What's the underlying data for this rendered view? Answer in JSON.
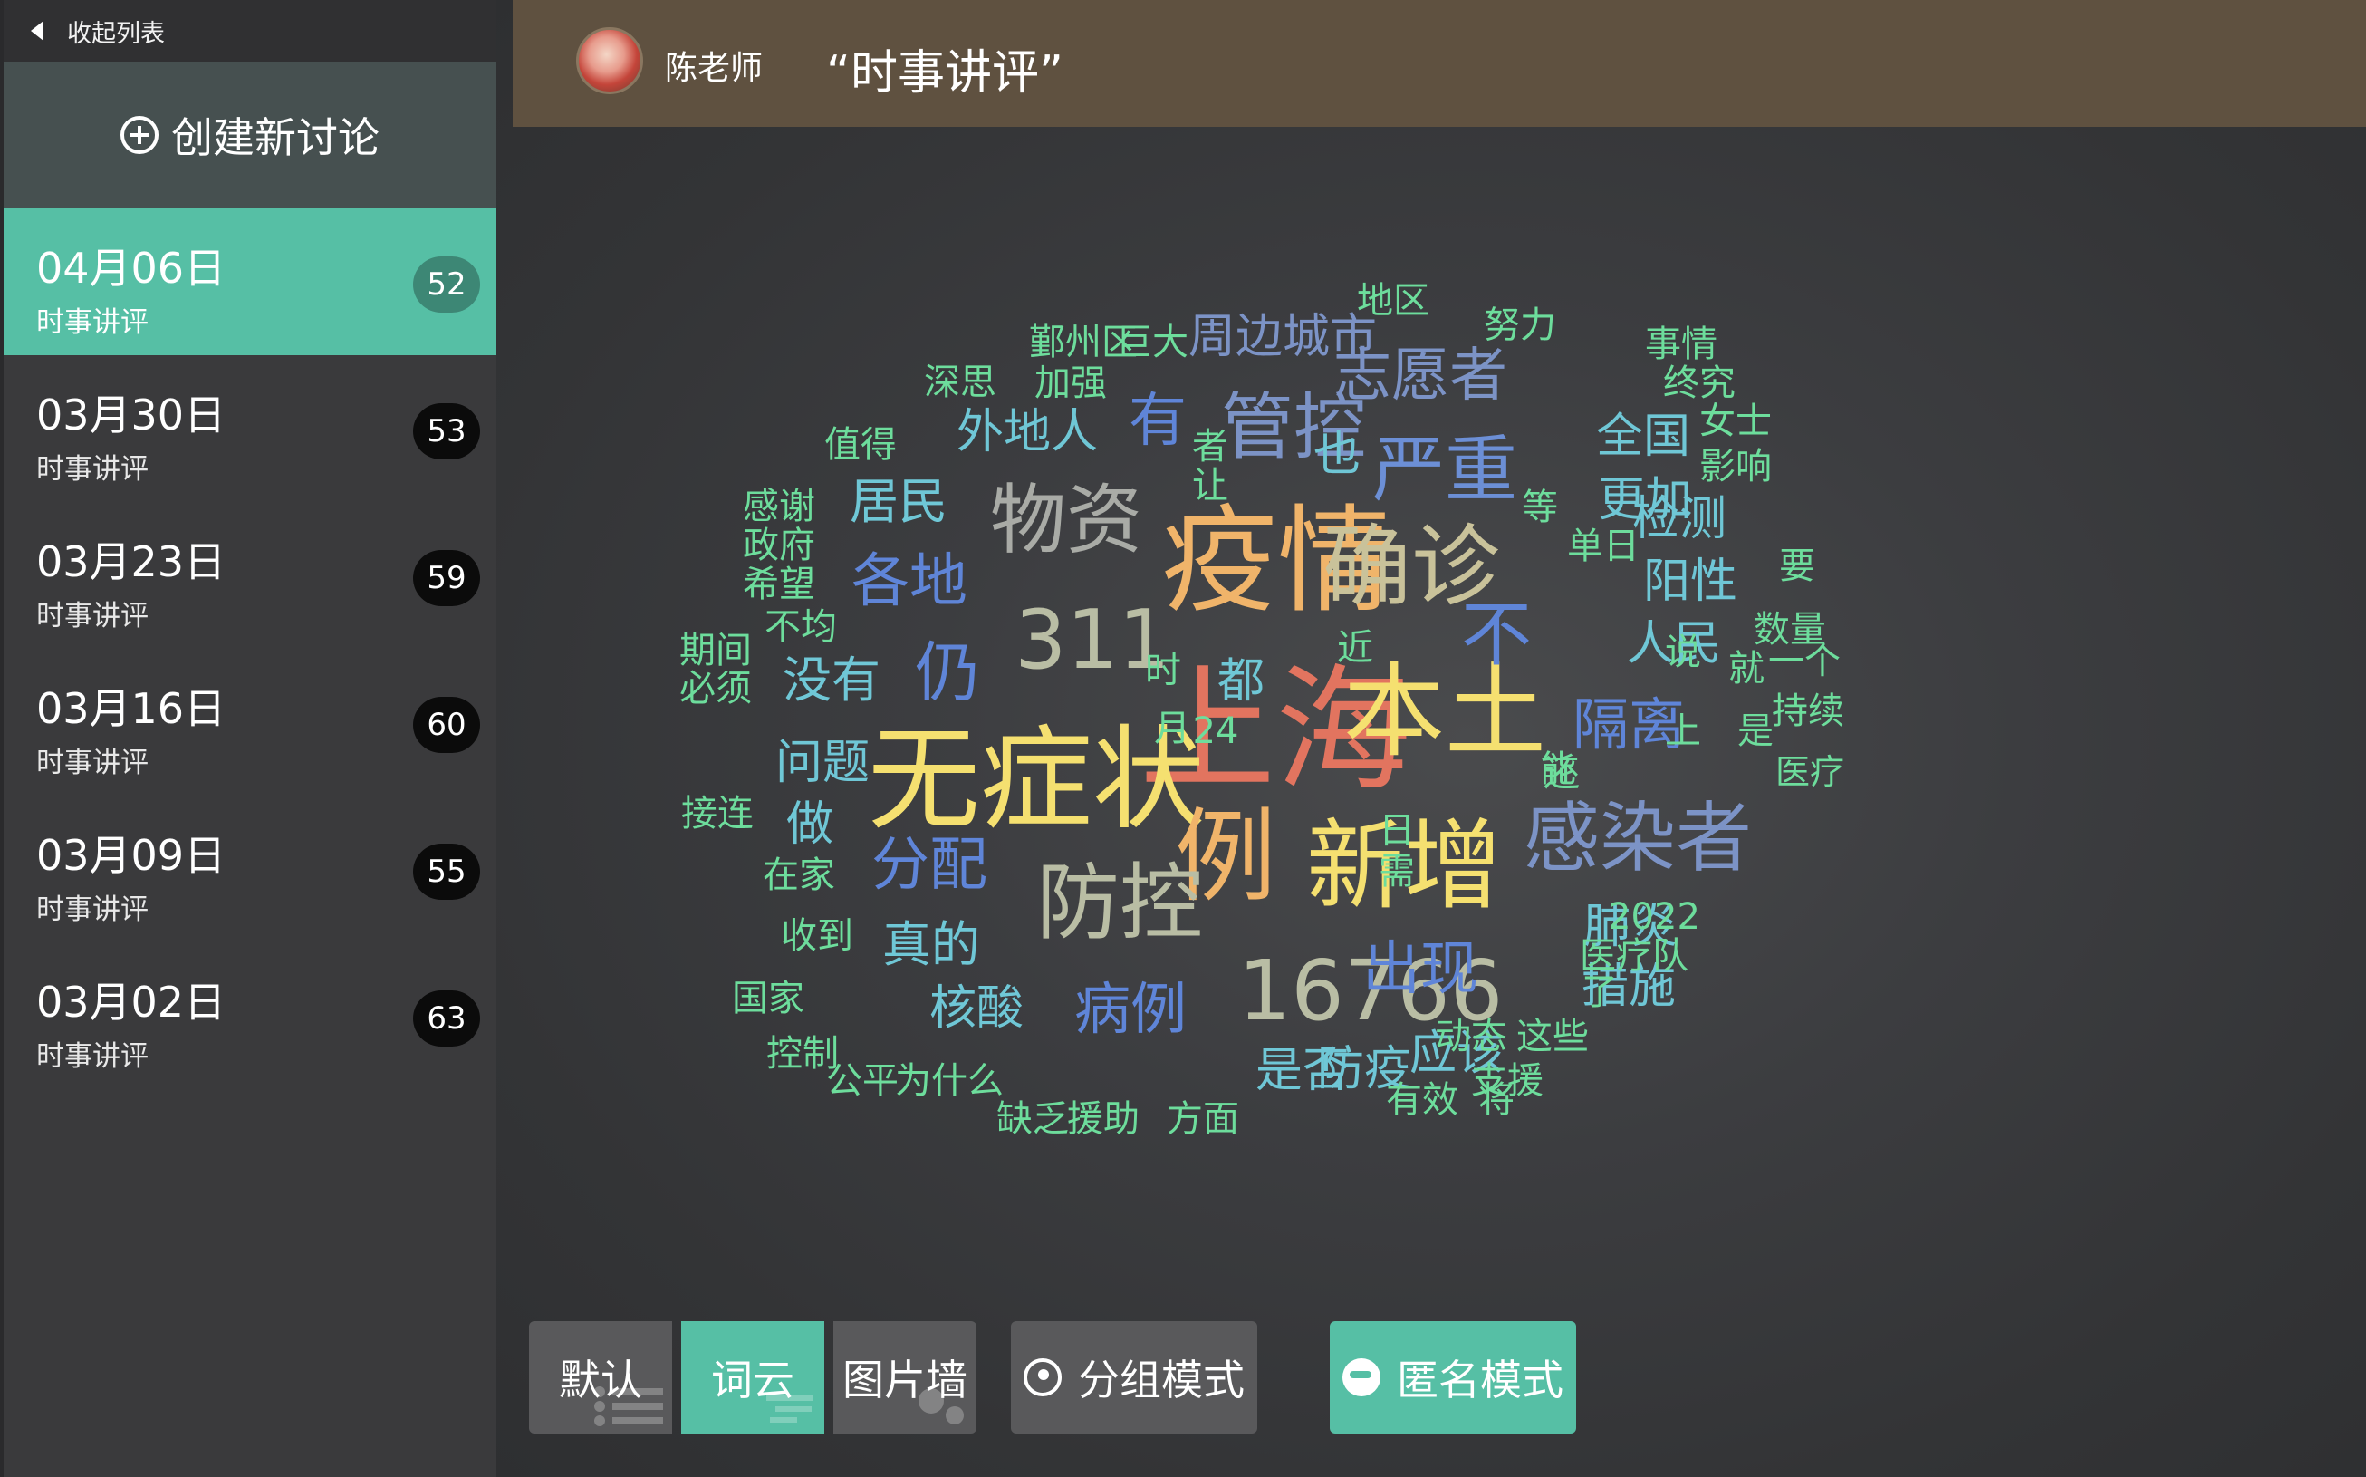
{
  "sidebar": {
    "collapse_label": "收起列表",
    "create_label": "创建新讨论",
    "items": [
      {
        "date": "04月06日",
        "subtitle": "时事讲评",
        "count": "52",
        "active": true
      },
      {
        "date": "03月30日",
        "subtitle": "时事讲评",
        "count": "53",
        "active": false
      },
      {
        "date": "03月23日",
        "subtitle": "时事讲评",
        "count": "59",
        "active": false
      },
      {
        "date": "03月16日",
        "subtitle": "时事讲评",
        "count": "60",
        "active": false
      },
      {
        "date": "03月09日",
        "subtitle": "时事讲评",
        "count": "55",
        "active": false
      },
      {
        "date": "03月02日",
        "subtitle": "时事讲评",
        "count": "63",
        "active": false
      }
    ]
  },
  "header": {
    "teacher_name": "陈老师",
    "topic_title": "“时事讲评”"
  },
  "toolbar": {
    "default_label": "默认",
    "cloud_label": "词云",
    "wall_label": "图片墙",
    "group_label": "分组模式",
    "anon_label": "匿名模式"
  },
  "colors": {
    "accent": "#56bfa5",
    "header_bg": "#5f5140",
    "sidebar_bg": "#3a3a3c",
    "badge_bg": "#0b0b0b"
  },
  "word_cloud": {
    "words": [
      {
        "text": "上海",
        "size": 150,
        "color": "#e2745f"
      },
      {
        "text": "疫情",
        "size": 128,
        "color": "#f0b46a"
      },
      {
        "text": "无症状",
        "size": 124,
        "color": "#f5e070"
      },
      {
        "text": "本土",
        "size": 112,
        "color": "#f5e070"
      },
      {
        "text": "新增",
        "size": 108,
        "color": "#f5e070"
      },
      {
        "text": "例",
        "size": 112,
        "color": "#f0b46a"
      },
      {
        "text": "确诊",
        "size": 98,
        "color": "#c9c29a"
      },
      {
        "text": "防控",
        "size": 92,
        "color": "#b9bda4"
      },
      {
        "text": "16766",
        "size": 92,
        "color": "#b9bda4"
      },
      {
        "text": "感染者",
        "size": 84,
        "color": "#7c93c6"
      },
      {
        "text": "311",
        "size": 90,
        "color": "#b9bda4"
      },
      {
        "text": "物资",
        "size": 84,
        "color": "#a9aba6"
      },
      {
        "text": "严重",
        "size": 80,
        "color": "#6c8fd6"
      },
      {
        "text": "管控",
        "size": 80,
        "color": "#7c93c6"
      },
      {
        "text": "不",
        "size": 78,
        "color": "#5f85d8"
      },
      {
        "text": "志愿者",
        "size": 64,
        "color": "#7c93c6"
      },
      {
        "text": "各地",
        "size": 64,
        "color": "#5f85d8"
      },
      {
        "text": "仍",
        "size": 72,
        "color": "#5f85d8"
      },
      {
        "text": "分配",
        "size": 64,
        "color": "#5f85d8"
      },
      {
        "text": "出现",
        "size": 64,
        "color": "#5f85d8"
      },
      {
        "text": "隔离",
        "size": 62,
        "color": "#5f85d8"
      },
      {
        "text": "有",
        "size": 64,
        "color": "#5f85d8"
      },
      {
        "text": "病例",
        "size": 62,
        "color": "#5f85d8"
      },
      {
        "text": "周边城市",
        "size": 52,
        "color": "#7c93c6"
      },
      {
        "text": "外地人",
        "size": 52,
        "color": "#6fc7d6"
      },
      {
        "text": "居民",
        "size": 54,
        "color": "#6fc7d6"
      },
      {
        "text": "没有",
        "size": 54,
        "color": "#6fc7d6"
      },
      {
        "text": "真的",
        "size": 54,
        "color": "#6fc7d6"
      },
      {
        "text": "核酸",
        "size": 52,
        "color": "#6fc7d6"
      },
      {
        "text": "问题",
        "size": 52,
        "color": "#6fc7d6"
      },
      {
        "text": "全国",
        "size": 52,
        "color": "#6fc7d6"
      },
      {
        "text": "更加",
        "size": 52,
        "color": "#6fc7d6"
      },
      {
        "text": "检测",
        "size": 52,
        "color": "#6fc7d6"
      },
      {
        "text": "阳性",
        "size": 52,
        "color": "#6fc7d6"
      },
      {
        "text": "人民",
        "size": 52,
        "color": "#6fc7d6"
      },
      {
        "text": "措施",
        "size": 52,
        "color": "#6fc7d6"
      },
      {
        "text": "肺炎",
        "size": 52,
        "color": "#6fc7d6"
      },
      {
        "text": "应该",
        "size": 52,
        "color": "#6fc7d6"
      },
      {
        "text": "防疫",
        "size": 52,
        "color": "#6fc7d6"
      },
      {
        "text": "是否",
        "size": 52,
        "color": "#6fc7d6"
      },
      {
        "text": "做",
        "size": 52,
        "color": "#6fc7d6"
      },
      {
        "text": "也",
        "size": 52,
        "color": "#6fc7d6"
      },
      {
        "text": "都",
        "size": 52,
        "color": "#6fc7d6"
      },
      {
        "text": "数量",
        "size": 40,
        "color": "#6ddd9c"
      },
      {
        "text": "持续",
        "size": 40,
        "color": "#6ddd9c"
      },
      {
        "text": "医疗",
        "size": 38,
        "color": "#6ddd9c"
      },
      {
        "text": "要",
        "size": 40,
        "color": "#6ddd9c"
      },
      {
        "text": "一个",
        "size": 40,
        "color": "#6ddd9c"
      },
      {
        "text": "女士",
        "size": 40,
        "color": "#6ddd9c"
      },
      {
        "text": "影响",
        "size": 40,
        "color": "#6ddd9c"
      },
      {
        "text": "事情",
        "size": 40,
        "color": "#6ddd9c"
      },
      {
        "text": "终究",
        "size": 40,
        "color": "#6ddd9c"
      },
      {
        "text": "努力",
        "size": 40,
        "color": "#6ddd9c"
      },
      {
        "text": "地区",
        "size": 40,
        "color": "#6ddd9c"
      },
      {
        "text": "鄞州区",
        "size": 40,
        "color": "#6ddd9c"
      },
      {
        "text": "巨大",
        "size": 40,
        "color": "#6ddd9c"
      },
      {
        "text": "深思",
        "size": 40,
        "color": "#6ddd9c"
      },
      {
        "text": "加强",
        "size": 40,
        "color": "#6ddd9c"
      },
      {
        "text": "值得",
        "size": 40,
        "color": "#6ddd9c"
      },
      {
        "text": "感谢",
        "size": 40,
        "color": "#6ddd9c"
      },
      {
        "text": "政府",
        "size": 40,
        "color": "#6ddd9c"
      },
      {
        "text": "希望",
        "size": 40,
        "color": "#6ddd9c"
      },
      {
        "text": "不均",
        "size": 40,
        "color": "#6ddd9c"
      },
      {
        "text": "期间",
        "size": 40,
        "color": "#6ddd9c"
      },
      {
        "text": "必须",
        "size": 40,
        "color": "#6ddd9c"
      },
      {
        "text": "接连",
        "size": 40,
        "color": "#6ddd9c"
      },
      {
        "text": "在家",
        "size": 40,
        "color": "#6ddd9c"
      },
      {
        "text": "收到",
        "size": 40,
        "color": "#6ddd9c"
      },
      {
        "text": "国家",
        "size": 40,
        "color": "#6ddd9c"
      },
      {
        "text": "控制",
        "size": 40,
        "color": "#6ddd9c"
      },
      {
        "text": "公平",
        "size": 40,
        "color": "#6ddd9c"
      },
      {
        "text": "为什么",
        "size": 40,
        "color": "#6ddd9c"
      },
      {
        "text": "缺乏",
        "size": 40,
        "color": "#6ddd9c"
      },
      {
        "text": "援助",
        "size": 40,
        "color": "#6ddd9c"
      },
      {
        "text": "方面",
        "size": 40,
        "color": "#6ddd9c"
      },
      {
        "text": "有效",
        "size": 40,
        "color": "#6ddd9c"
      },
      {
        "text": "将",
        "size": 40,
        "color": "#6ddd9c"
      },
      {
        "text": "支援",
        "size": 40,
        "color": "#6ddd9c"
      },
      {
        "text": "动态",
        "size": 40,
        "color": "#6ddd9c"
      },
      {
        "text": "这些",
        "size": 40,
        "color": "#6ddd9c"
      },
      {
        "text": "了",
        "size": 40,
        "color": "#6ddd9c"
      },
      {
        "text": "医疗队",
        "size": 40,
        "color": "#6ddd9c"
      },
      {
        "text": "2022",
        "size": 40,
        "color": "#6ddd9c"
      },
      {
        "text": "单日",
        "size": 40,
        "color": "#6ddd9c"
      },
      {
        "text": "等",
        "size": 40,
        "color": "#6ddd9c"
      },
      {
        "text": "说",
        "size": 40,
        "color": "#6ddd9c"
      },
      {
        "text": "就",
        "size": 40,
        "color": "#6ddd9c"
      },
      {
        "text": "是",
        "size": 40,
        "color": "#6ddd9c"
      },
      {
        "text": "上",
        "size": 40,
        "color": "#6ddd9c"
      },
      {
        "text": "还",
        "size": 40,
        "color": "#6ddd9c"
      },
      {
        "text": "能",
        "size": 40,
        "color": "#6ddd9c"
      },
      {
        "text": "近",
        "size": 40,
        "color": "#6ddd9c"
      },
      {
        "text": "时",
        "size": 40,
        "color": "#6ddd9c"
      },
      {
        "text": "月",
        "size": 40,
        "color": "#6ddd9c"
      },
      {
        "text": "24",
        "size": 40,
        "color": "#6ddd9c"
      },
      {
        "text": "日",
        "size": 40,
        "color": "#6ddd9c"
      },
      {
        "text": "需",
        "size": 40,
        "color": "#6ddd9c"
      },
      {
        "text": "者",
        "size": 40,
        "color": "#6ddd9c"
      },
      {
        "text": "让",
        "size": 40,
        "color": "#6ddd9c"
      }
    ]
  }
}
